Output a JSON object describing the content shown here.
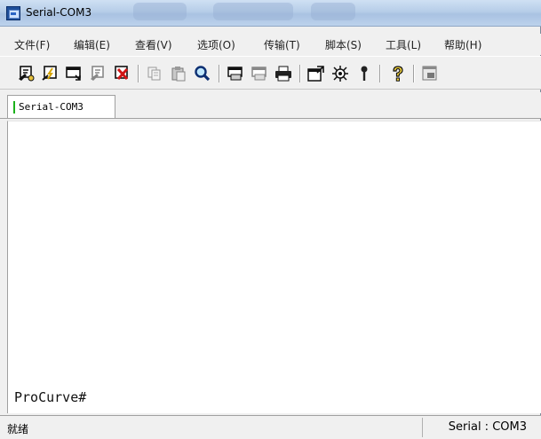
{
  "window": {
    "title": "Serial-COM3"
  },
  "menu": [
    {
      "id": "file",
      "label": "文件(F)"
    },
    {
      "id": "edit",
      "label": "编辑(E)"
    },
    {
      "id": "view",
      "label": "查看(V)"
    },
    {
      "id": "options",
      "label": "选项(O)"
    },
    {
      "id": "transfer",
      "label": "传输(T)"
    },
    {
      "id": "script",
      "label": "脚本(S)"
    },
    {
      "id": "tools",
      "label": "工具(L)"
    },
    {
      "id": "help",
      "label": "帮助(H)"
    }
  ],
  "toolbar": {
    "icons": [
      "connect-icon",
      "quick-connect-icon",
      "connect-in-tab-icon",
      "reconnect-icon",
      "disconnect-icon",
      "copy-icon",
      "paste-icon",
      "find-icon",
      "print-screen-icon",
      "print-selection-icon",
      "printer-icon",
      "session-options-icon",
      "global-options-icon",
      "keymap-icon",
      "help-icon",
      "sftp-icon"
    ]
  },
  "tabs": [
    {
      "label": "Serial-COM3",
      "status_color": "#1bb11b"
    }
  ],
  "terminal": {
    "lines": [
      "ProCurve#"
    ]
  },
  "status": {
    "left": "就绪",
    "right": "Serial : COM3"
  }
}
